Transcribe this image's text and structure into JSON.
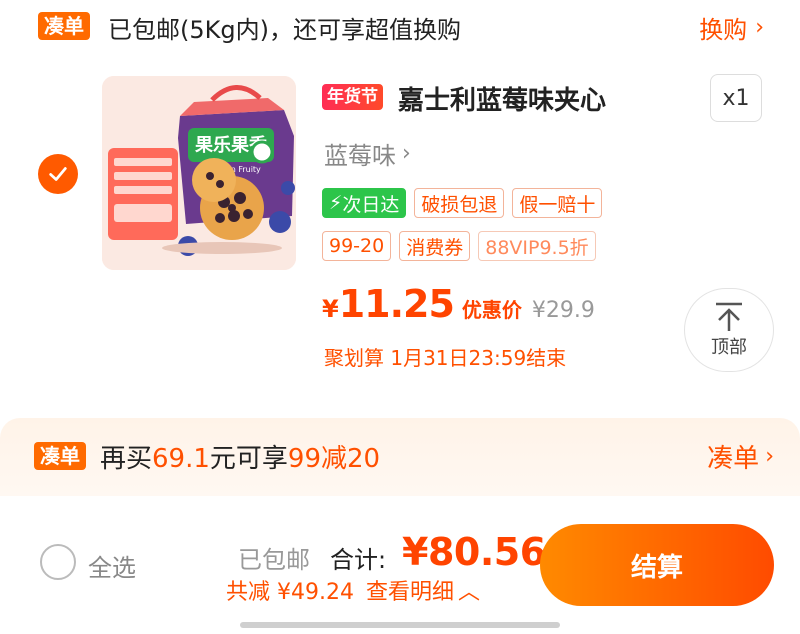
{
  "top_bar": {
    "tag": "凑单",
    "text": "已包邮(5Kg内)，还可享超值换购",
    "exchange_label": "换购"
  },
  "item": {
    "selected": true,
    "promo_tag": "年货节",
    "title": "嘉士利蓝莓味夹心",
    "quantity": "x1",
    "variant": "蓝莓味",
    "image_box_text": "果乐果香",
    "image_box_subtext": "Fruit Fun Fruity",
    "badges": [
      "次日达",
      "破损包退",
      "假一赔十",
      "99-20",
      "消费券",
      "88VIP9.5折"
    ],
    "price_symbol": "¥",
    "price": "11.25",
    "price_label": "优惠价",
    "original_price": "¥29.9",
    "deadline": "聚划算 1月31日23:59结束"
  },
  "scroll_top": {
    "label": "顶部"
  },
  "addon": {
    "tag": "凑单",
    "text_prefix": "再买",
    "amount": "69.1",
    "text_mid": "元可享",
    "deal": "99减20",
    "link_label": "凑单"
  },
  "footer": {
    "select_all": "全选",
    "free_shipping": "已包邮",
    "total_label": "合计:",
    "total": "¥80.56",
    "saving": "共减 ¥49.24",
    "details_label": "查看明细",
    "checkout_label": "结算"
  },
  "colors": {
    "accent": "#ff5000",
    "checkout_start": "#ff8a00",
    "checkout_end": "#ff4b00",
    "next_day_green": "#2cc54a",
    "promo_red": "#ff2d55"
  }
}
